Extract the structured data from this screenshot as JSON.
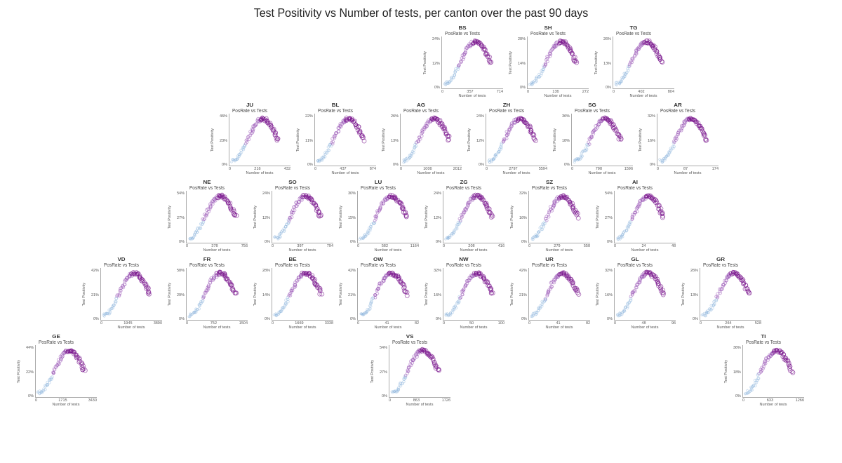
{
  "title": "Test Positivity vs Number of tests, per canton over the past 90 days",
  "charts": [
    {
      "row": 0,
      "cantons": [
        {
          "id": "BS",
          "title": "PosRate vs Tests",
          "ymax": "24%",
          "ymid": "12%",
          "ymin": "0%",
          "xmin": "0",
          "xmid": "357",
          "xmax": "714",
          "color1": "#7b2d8b",
          "color2": "#9ec8e8",
          "shape": "s-curve-right"
        },
        {
          "id": "SH",
          "title": "PosRate vs Tests",
          "ymax": "28%",
          "ymid": "14%",
          "ymin": "0%",
          "xmin": "0",
          "xmid": "136",
          "xmax": "272",
          "color1": "#7b2d8b",
          "color2": "#9ec8e8",
          "shape": "s-curve-right"
        },
        {
          "id": "TG",
          "title": "PosRate vs Tests",
          "ymax": "26%",
          "ymid": "13%",
          "ymin": "0%",
          "xmin": "0",
          "xmid": "402",
          "xmax": "804",
          "color1": "#7b2d8b",
          "color2": "#9ec8e8",
          "shape": "s-curve-right"
        }
      ]
    },
    {
      "row": 1,
      "cantons": [
        {
          "id": "JU",
          "title": "PosRate vs Tests",
          "ymax": "46%",
          "ymid": "23%",
          "ymin": "0%",
          "xmin": "0",
          "xmid": "216",
          "xmax": "432",
          "color1": "#7b2d8b",
          "color2": "#9ec8e8",
          "shape": "s-curve-left"
        },
        {
          "id": "BL",
          "title": "PosRate vs Tests",
          "ymax": "22%",
          "ymid": "11%",
          "ymin": "0%",
          "xmin": "0",
          "xmid": "437",
          "xmax": "874",
          "color1": "#7b2d8b",
          "color2": "#9ec8e8",
          "shape": "s-curve-right"
        },
        {
          "id": "AG",
          "title": "PosRate vs Tests",
          "ymax": "26%",
          "ymid": "13%",
          "ymin": "0%",
          "xmin": "0",
          "xmid": "1006",
          "xmax": "2012",
          "color1": "#7b2d8b",
          "color2": "#9ec8e8",
          "shape": "s-curve-right"
        },
        {
          "id": "ZH",
          "title": "PosRate vs Tests",
          "ymax": "24%",
          "ymid": "12%",
          "ymin": "0%",
          "xmin": "0",
          "xmid": "2797",
          "xmax": "5594",
          "color1": "#7b2d8b",
          "color2": "#9ec8e8",
          "shape": "s-curve-right"
        },
        {
          "id": "SG",
          "title": "PosRate vs Tests",
          "ymax": "36%",
          "ymid": "18%",
          "ymin": "0%",
          "xmin": "0",
          "xmid": "798",
          "xmax": "1596",
          "color1": "#7b2d8b",
          "color2": "#9ec8e8",
          "shape": "s-curve-right"
        },
        {
          "id": "AR",
          "title": "PosRate vs Tests",
          "ymax": "32%",
          "ymid": "16%",
          "ymin": "0%",
          "xmin": "0",
          "xmid": "87",
          "xmax": "174",
          "color1": "#7b2d8b",
          "color2": "#9ec8e8",
          "shape": "s-curve-right"
        }
      ]
    },
    {
      "row": 2,
      "cantons": [
        {
          "id": "NE",
          "title": "PosRate vs Tests",
          "ymax": "54%",
          "ymid": "27%",
          "ymin": "0%",
          "xmin": "0",
          "xmid": "378",
          "xmax": "756",
          "color1": "#7b2d8b",
          "color2": "#9ec8e8",
          "shape": "s-curve-right"
        },
        {
          "id": "SO",
          "title": "PosRate vs Tests",
          "ymax": "24%",
          "ymid": "12%",
          "ymin": "0%",
          "xmin": "0",
          "xmid": "397",
          "xmax": "794",
          "color1": "#7b2d8b",
          "color2": "#9ec8e8",
          "shape": "s-curve-right"
        },
        {
          "id": "LU",
          "title": "PosRate vs Tests",
          "ymax": "30%",
          "ymid": "15%",
          "ymin": "0%",
          "xmin": "0",
          "xmid": "582",
          "xmax": "1164",
          "color1": "#7b2d8b",
          "color2": "#9ec8e8",
          "shape": "s-curve-right"
        },
        {
          "id": "ZG",
          "title": "PosRate vs Tests",
          "ymax": "24%",
          "ymid": "12%",
          "ymin": "0%",
          "xmin": "0",
          "xmid": "208",
          "xmax": "416",
          "color1": "#7b2d8b",
          "color2": "#9ec8e8",
          "shape": "s-curve-right"
        },
        {
          "id": "SZ",
          "title": "PosRate vs Tests",
          "ymax": "32%",
          "ymid": "16%",
          "ymin": "0%",
          "xmin": "0",
          "xmid": "279",
          "xmax": "558",
          "color1": "#7b2d8b",
          "color2": "#9ec8e8",
          "shape": "s-curve-right"
        },
        {
          "id": "AI",
          "title": "PosRate vs Tests",
          "ymax": "54%",
          "ymid": "27%",
          "ymin": "0%",
          "xmin": "0",
          "xmid": "24",
          "xmax": "48",
          "color1": "#7b2d8b",
          "color2": "#9ec8e8",
          "shape": "s-curve-right"
        }
      ]
    },
    {
      "row": 3,
      "cantons": [
        {
          "id": "VD",
          "title": "PosRate vs Tests",
          "ymax": "42%",
          "ymid": "21%",
          "ymin": "0%",
          "xmin": "0",
          "xmid": "1945",
          "xmax": "3890",
          "color1": "#7b2d8b",
          "color2": "#9ec8e8",
          "shape": "s-curve-right"
        },
        {
          "id": "FR",
          "title": "PosRate vs Tests",
          "ymax": "58%",
          "ymid": "29%",
          "ymin": "0%",
          "xmin": "0",
          "xmid": "752",
          "xmax": "1504",
          "color1": "#7b2d8b",
          "color2": "#9ec8e8",
          "shape": "s-curve-right"
        },
        {
          "id": "BE",
          "title": "PosRate vs Tests",
          "ymax": "28%",
          "ymid": "14%",
          "ymin": "0%",
          "xmin": "0",
          "xmid": "1669",
          "xmax": "3338",
          "color1": "#7b2d8b",
          "color2": "#9ec8e8",
          "shape": "s-curve-right"
        },
        {
          "id": "OW",
          "title": "PosRate vs Tests",
          "ymax": "42%",
          "ymid": "21%",
          "ymin": "0%",
          "xmin": "0",
          "xmid": "41",
          "xmax": "82",
          "color1": "#7b2d8b",
          "color2": "#9ec8e8",
          "shape": "s-curve-right"
        },
        {
          "id": "NW",
          "title": "PosRate vs Tests",
          "ymax": "32%",
          "ymid": "16%",
          "ymin": "0%",
          "xmin": "0",
          "xmid": "50",
          "xmax": "100",
          "color1": "#7b2d8b",
          "color2": "#9ec8e8",
          "shape": "s-curve-right"
        },
        {
          "id": "UR",
          "title": "PosRate vs Tests",
          "ymax": "42%",
          "ymid": "21%",
          "ymin": "0%",
          "xmin": "0",
          "xmid": "41",
          "xmax": "82",
          "color1": "#7b2d8b",
          "color2": "#9ec8e8",
          "shape": "s-curve-right"
        },
        {
          "id": "GL",
          "title": "PosRate vs Tests",
          "ymax": "32%",
          "ymid": "16%",
          "ymin": "0%",
          "xmin": "0",
          "xmid": "48",
          "xmax": "96",
          "color1": "#7b2d8b",
          "color2": "#9ec8e8",
          "shape": "s-curve-right"
        },
        {
          "id": "GR",
          "title": "PosRate vs Tests",
          "ymax": "26%",
          "ymid": "13%",
          "ymin": "0%",
          "xmin": "0",
          "xmid": "264",
          "xmax": "528",
          "color1": "#7b2d8b",
          "color2": "#9ec8e8",
          "shape": "s-curve-right"
        }
      ]
    },
    {
      "row": 4,
      "cantons": [
        {
          "id": "GE",
          "title": "PosRate vs Tests",
          "ymax": "44%",
          "ymid": "22%",
          "ymin": "0%",
          "xmin": "0",
          "xmid": "1715",
          "xmax": "3430",
          "color1": "#7b2d8b",
          "color2": "#9ec8e8",
          "shape": "s-curve-right",
          "offset": 0
        },
        {
          "id": "VS",
          "title": "PosRate vs Tests",
          "ymax": "54%",
          "ymid": "27%",
          "ymin": "0%",
          "xmin": "0",
          "xmid": "863",
          "xmax": "1726",
          "color1": "#7b2d8b",
          "color2": "#9ec8e8",
          "shape": "s-curve-right",
          "offset": 3
        },
        {
          "id": "TI",
          "title": "PosRate vs Tests",
          "ymax": "36%",
          "ymid": "18%",
          "ymin": "0%",
          "xmin": "0",
          "xmid": "633",
          "xmax": "1266",
          "color1": "#7b2d8b",
          "color2": "#9ec8e8",
          "shape": "s-curve-right",
          "offset": 6
        }
      ]
    }
  ]
}
